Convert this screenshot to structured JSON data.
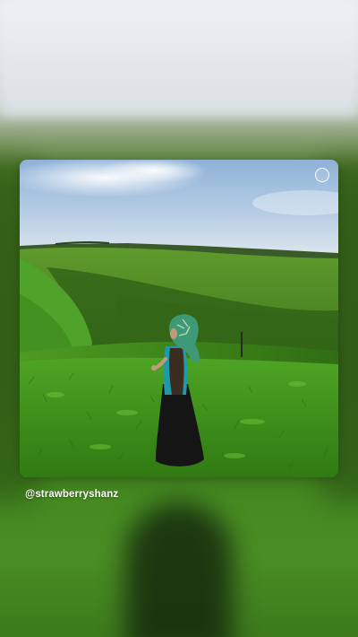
{
  "story": {
    "author_handle": "@strawberryshanz",
    "photo_icon": "select-circle-icon"
  }
}
